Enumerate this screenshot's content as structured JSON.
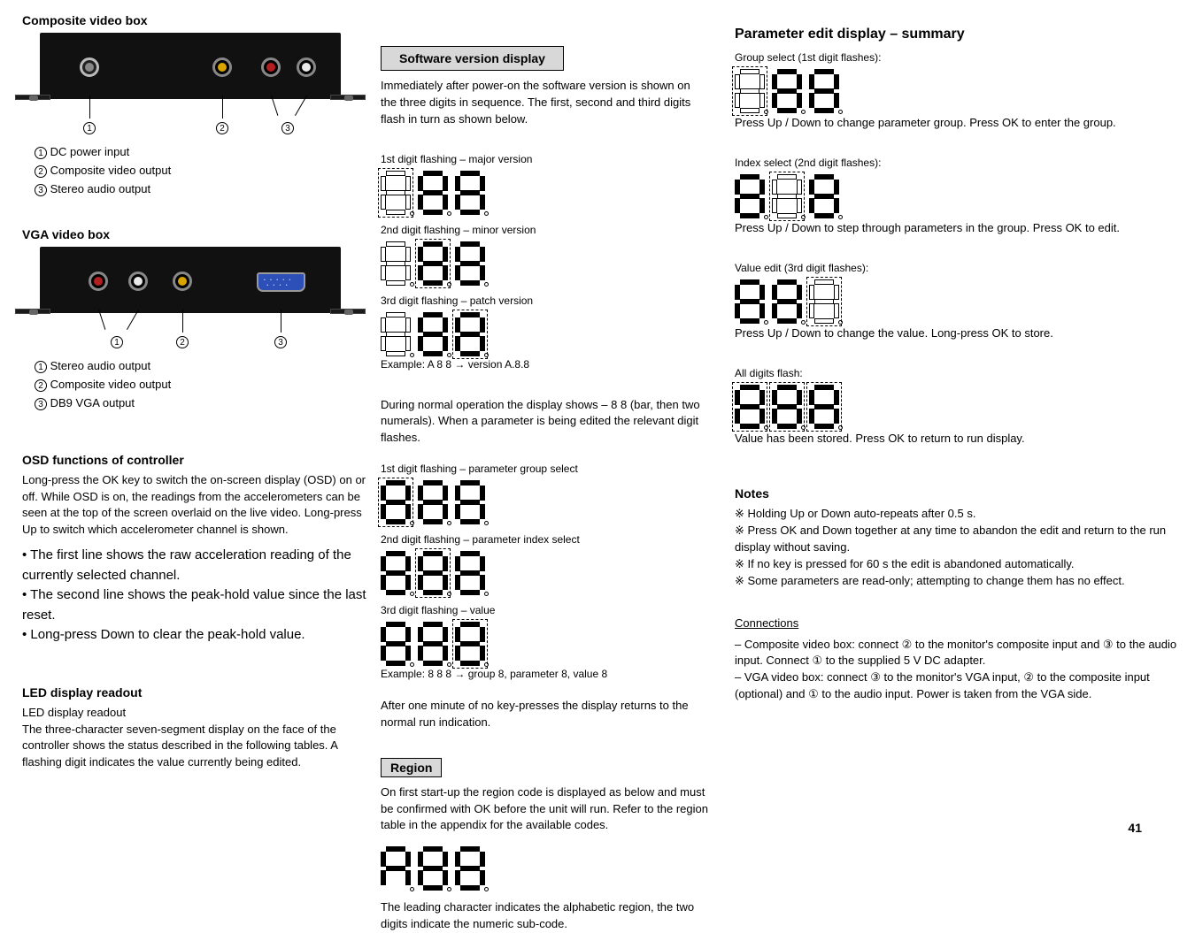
{
  "col1": {
    "h_composite": "Composite video box",
    "composite_items": {
      "i1": "DC power input",
      "i2": "Composite video output",
      "i3": "Stereo audio output"
    },
    "h_vga": "VGA video box",
    "vga_items": {
      "i1": "Stereo audio output",
      "i2": "Composite video output",
      "i3": "DB9 VGA output"
    },
    "h_osd": "OSD functions of controller",
    "osd_body": "Long-press the OK key to switch the on-screen display (OSD) on or off. While OSD is on, the readings from the accelerometers can be seen at the top of the screen overlaid on the live video. Long-press Up to switch which accelerometer channel is shown.",
    "osd_bullets": {
      "b1": "• The first line shows the raw acceleration reading of the currently selected channel.",
      "b2": "• The second line shows the peak-hold value since the last reset.",
      "b3": "• Long-press Down to clear the peak-hold value."
    },
    "h_led": "LED display readout",
    "led_body": "The three-character seven-segment display on the face of the controller shows the status described in the following tables. A flashing digit indicates the value currently being edited."
  },
  "col2": {
    "box_software": "Software version display",
    "software_body": "Immediately after power-on the software version is shown on the three digits in sequence. The first, second and third digits flash in turn as shown below.",
    "literal_rows": {
      "r1": "1st digit flashing – major version",
      "r2": "2nd digit flashing – minor version",
      "r3": "3rd digit flashing – patch version"
    },
    "eg": "Example: A 8 8 → version A.8.8",
    "mid_body": "During normal operation the display shows – 8 8 (bar, then two numerals). When a parameter is being edited the relevant digit flashes.",
    "literal_rows2": {
      "r1": "1st digit flashing – parameter group select",
      "r2": "2nd digit flashing – parameter index select",
      "r3": "3rd digit flashing – value"
    },
    "eg2": "Example: 8 8 8 → group 8, parameter 8, value 8",
    "foot": "After one minute of no key-presses the display returns to the normal run indication.",
    "box_region": "Region",
    "region_body": "On first start-up the region code is displayed as below and must be confirmed with OK before the unit will run. Refer to the region table in the appendix for the available codes.",
    "region_digits": "A 8 8",
    "region_note": "The leading character indicates the alphabetic region, the two digits indicate the numeric sub-code."
  },
  "col3": {
    "title": "Parameter edit display – summary",
    "rows": {
      "r1": {
        "name": "Group select (1st digit flashes):",
        "hint": "Press Up / Down to change parameter group. Press OK to enter the group."
      },
      "r2": {
        "name": "Index select (2nd digit flashes):",
        "hint": "Press Up / Down to step through parameters in the group. Press OK to edit."
      },
      "r3": {
        "name": "Value edit (3rd digit flashes):",
        "hint": "Press Up / Down to change the value. Long-press OK to store."
      },
      "r4": {
        "name": "All digits flash:",
        "hint": "Value has been stored. Press OK to return to run display."
      }
    },
    "notes_title": "Notes",
    "notes": {
      "n1": "※ Holding Up or Down auto-repeats after 0.5 s.",
      "n2": "※ Press OK and Down together at any time to abandon the edit and return to the run display without saving.",
      "n3": "※ If no key is pressed for 60 s the edit is abandoned automatically.",
      "n4": "※ Some parameters are read-only; attempting to change them has no effect."
    },
    "connection_title": "Connections",
    "connection_body": "  – Composite video box: connect ② to the monitor's composite input and ③ to the audio input. Connect ① to the supplied 5 V DC adapter.\n  – VGA video box: connect ③ to the monitor's VGA input, ② to the composite input (optional) and ① to the audio input. Power is taken from the VGA side.",
    "page": "41"
  }
}
